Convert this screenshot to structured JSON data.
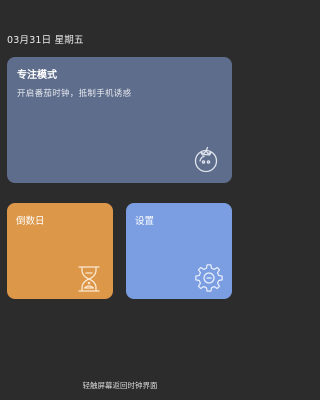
{
  "header": {
    "date": "03月31日 星期五"
  },
  "focus_card": {
    "title": "专注模式",
    "subtitle": "开启番茄时钟，抵制手机诱惑",
    "icon": "tomato-icon",
    "color": "#5e6d8b"
  },
  "countdown_tile": {
    "label": "倒数日",
    "icon": "hourglass-icon",
    "color": "#dc9748"
  },
  "settings_tile": {
    "label": "设置",
    "icon": "gear-icon",
    "color": "#7b9ee2"
  },
  "footer": {
    "hint": "轻触屏幕返回时钟界面"
  }
}
